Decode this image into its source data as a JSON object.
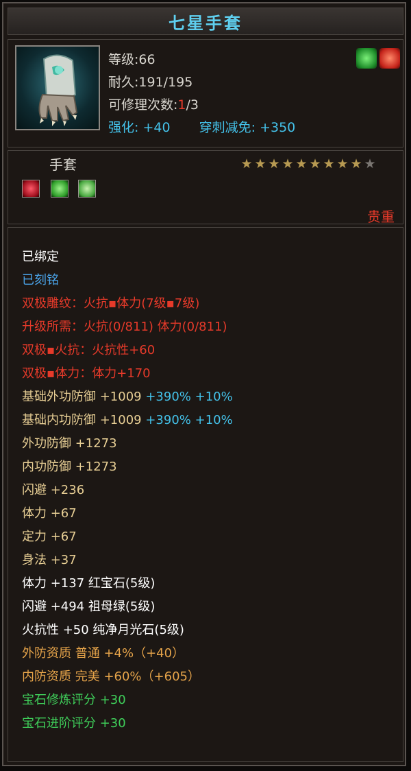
{
  "title": "七星手套",
  "colors": {
    "title": "#5fd0f0",
    "red": "#e63a2a",
    "cyan": "#44c2ea",
    "tan": "#e8cf95",
    "gold": "#e6a44a",
    "green": "#3fcf5a"
  },
  "header": {
    "level_label": "等级:",
    "level_value": "66",
    "durability_label": "耐久:",
    "durability_value": "191/195",
    "repair_label": "可修理次数:",
    "repair_used": "1",
    "repair_total": "/3",
    "enhance_label": "强化:",
    "enhance_value": "+40",
    "pierce_label": "穿刺减免:",
    "pierce_value": "+350",
    "badges": [
      "green-dragon-icon",
      "red-flame-icon"
    ]
  },
  "type_row": {
    "item_type": "手套",
    "stars_filled": 9,
    "stars_total": 10,
    "gems": [
      "ruby-gem-icon",
      "emerald-gem-icon",
      "moonstone-gem-icon"
    ],
    "rarity": "贵重"
  },
  "attributes": {
    "bound": "已绑定",
    "engraved": "已刻铭",
    "double_pole_line": "双极雕纹：火抗▪体力(7级▪7级)",
    "upgrade_need": "升级所需：火抗(0/811) 体力(0/811)",
    "fire_resist": "双极▪火抗：火抗性+60",
    "stamina": "双极▪体力：体力+170",
    "base_outer": {
      "label": "基础外功防御 +1009",
      "extra": " +390% +10%"
    },
    "base_inner": {
      "label": "基础内功防御 +1009",
      "extra": " +390% +10%"
    },
    "outer_def": "外功防御 +1273",
    "inner_def": "内功防御 +1273",
    "dodge": "闪避 +236",
    "stamina_stat": "体力 +67",
    "focus": "定力 +67",
    "agility": "身法 +37",
    "gem1": "体力 +137 红宝石(5级)",
    "gem2": "闪避 +494 祖母绿(5级)",
    "gem3": "火抗性 +50 纯净月光石(5级)",
    "outer_quality": "外防资质  普通 +4%（+40）",
    "inner_quality": "内防资质  完美 +60%（+605）",
    "gem_refine": "宝石修炼评分 +30",
    "gem_advance": "宝石进阶评分 +30"
  }
}
